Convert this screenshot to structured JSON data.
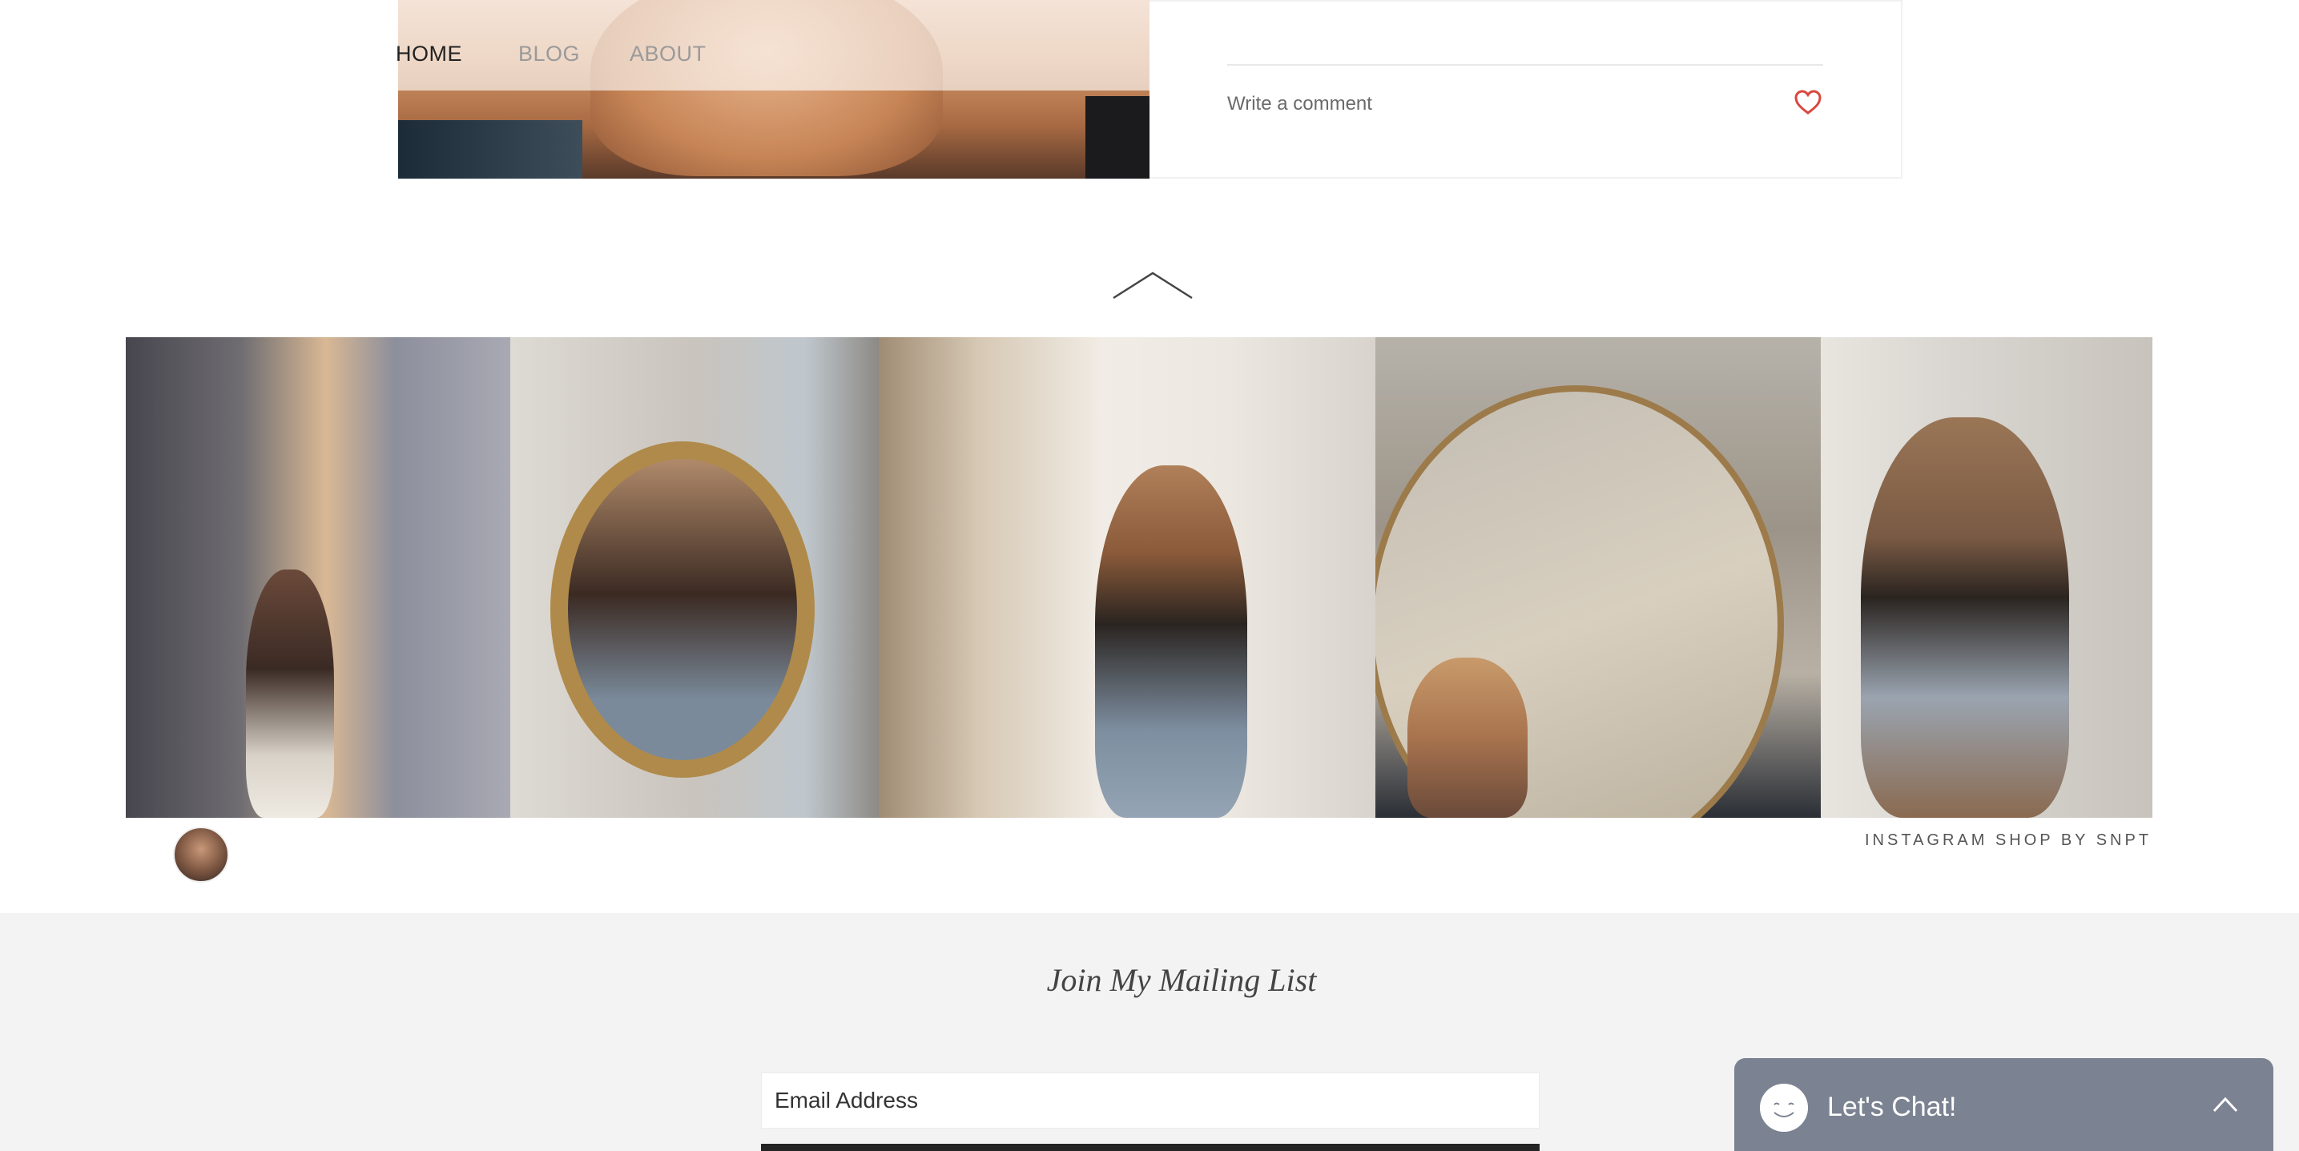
{
  "nav": {
    "items": [
      {
        "label": "HOME"
      },
      {
        "label": "BLOG"
      },
      {
        "label": "ABOUT"
      }
    ]
  },
  "post": {
    "comment_placeholder": "Write a comment",
    "like_icon": "heart-icon"
  },
  "back_to_top_icon": "chevron-up-icon",
  "instagram": {
    "tiles": [
      {
        "alt": "instagram-photo-curtains"
      },
      {
        "alt": "instagram-photo-gold-mirror"
      },
      {
        "alt": "instagram-photo-window"
      },
      {
        "alt": "instagram-photo-round-mirror"
      },
      {
        "alt": "instagram-photo-selfie"
      }
    ],
    "credit": "INSTAGRAM SHOP BY SNPT"
  },
  "mailing": {
    "title": "Join My Mailing List",
    "email_placeholder": "Email Address"
  },
  "chat": {
    "label": "Let's Chat!",
    "colors": {
      "background": "#7b8291"
    }
  },
  "colors": {
    "heart": "#d9473f",
    "mailing_background": "#f3f3f3"
  }
}
